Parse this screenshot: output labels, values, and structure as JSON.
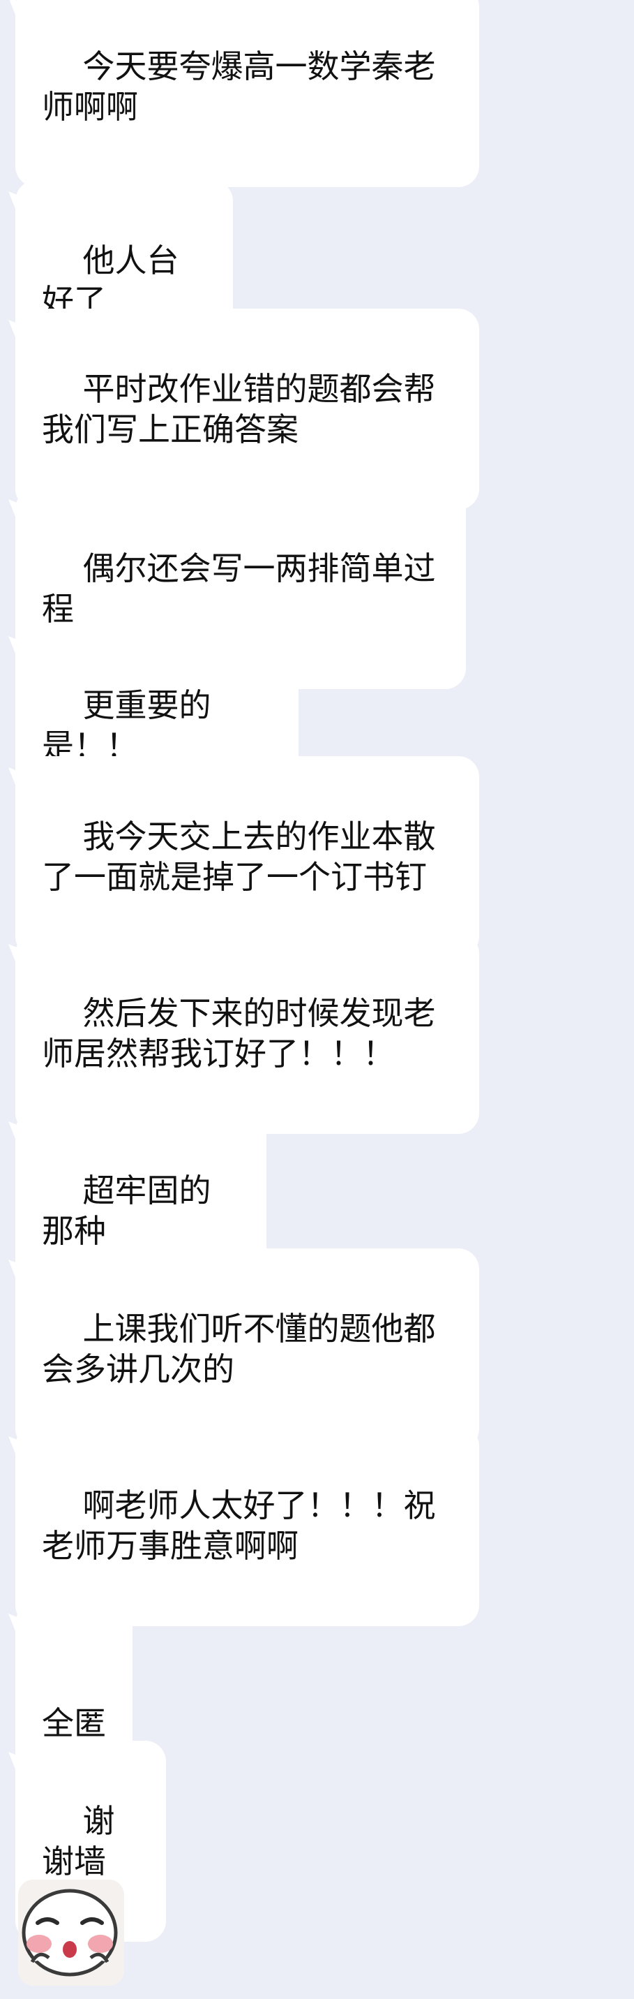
{
  "chat": {
    "background_color": "#eceef7",
    "bubble_color": "#ffffff",
    "messages": [
      {
        "text": "今天要夸爆高一数学秦老师啊啊"
      },
      {
        "text": "他人台好了"
      },
      {
        "text": "平时改作业错的题都会帮我们写上正确答案"
      },
      {
        "text": "偶尔还会写一两排简单过程"
      },
      {
        "text": "更重要的是！！"
      },
      {
        "text": "我今天交上去的作业本散了一面就是掉了一个订书钉"
      },
      {
        "text": "然后发下来的时候发现老师居然帮我订好了！！！"
      },
      {
        "text": "超牢固的那种"
      },
      {
        "text": "上课我们听不懂的题他都会多讲几次的"
      },
      {
        "text": "啊老师人太好了！！！祝老师万事胜意啊啊"
      },
      {
        "text": "全匿"
      },
      {
        "text": "谢谢墙"
      }
    ],
    "sticker": {
      "icon": "cute-blushing-face-sticker"
    }
  }
}
